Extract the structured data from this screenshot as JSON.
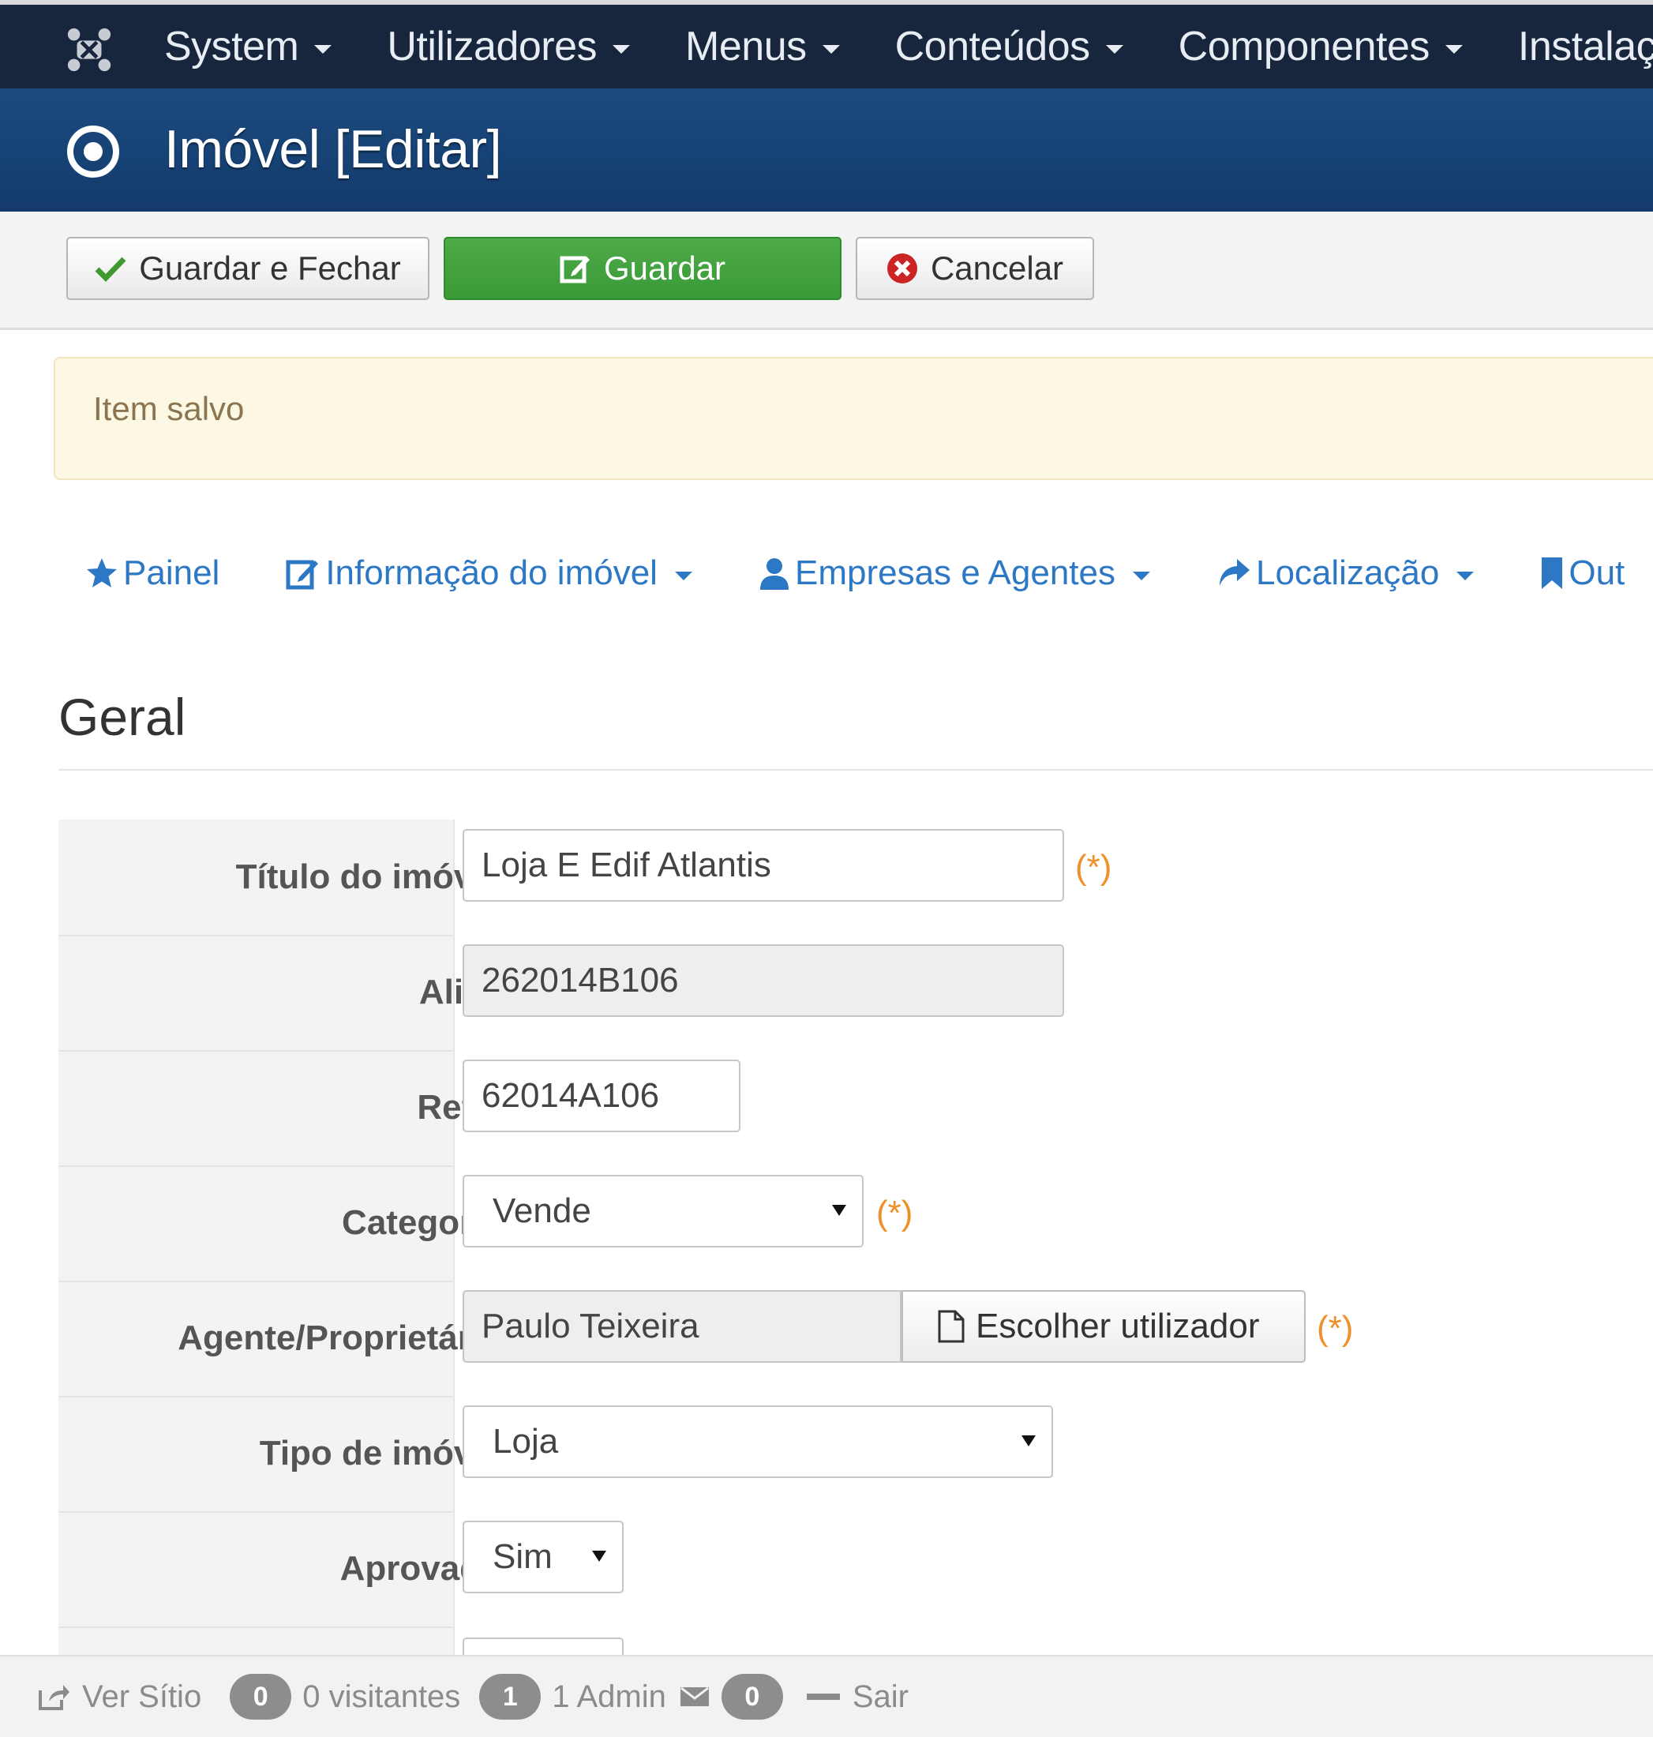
{
  "topnav": {
    "items": [
      {
        "label": "System"
      },
      {
        "label": "Utilizadores"
      },
      {
        "label": "Menus"
      },
      {
        "label": "Conteúdos"
      },
      {
        "label": "Componentes"
      },
      {
        "label": "Instalaç"
      }
    ]
  },
  "header": {
    "title": "Imóvel [Editar]"
  },
  "toolbar": {
    "save_close_label": "Guardar e Fechar",
    "save_label": "Guardar",
    "cancel_label": "Cancelar"
  },
  "alert": {
    "message": "Item salvo"
  },
  "tabs": [
    {
      "label": "Painel",
      "icon": "star-icon"
    },
    {
      "label": "Informação do imóvel",
      "icon": "edit-icon"
    },
    {
      "label": "Empresas e Agentes",
      "icon": "user-icon"
    },
    {
      "label": "Localização",
      "icon": "share-icon"
    },
    {
      "label": "Out",
      "icon": "bookmark-icon"
    }
  ],
  "section": {
    "title": "Geral"
  },
  "form": {
    "required_marker": "(*)",
    "title_label": "Título do imóvel",
    "title_value": "Loja E Edif Atlantis",
    "alias_label": "Alias",
    "alias_value": "262014B106",
    "ref_label": "Ref #",
    "ref_value": "62014A106",
    "category_label": "Categoria",
    "category_value": "Vende",
    "agent_label": "Agente/Proprietário",
    "agent_value": "Paulo Teixeira",
    "choose_user_label": "Escolher utilizador",
    "type_label": "Tipo de imóvel",
    "type_value": "Loja",
    "approved_label": "Aprovado",
    "approved_value": "Sim"
  },
  "statusbar": {
    "view_site_label": "Ver Sítio",
    "visitors_count": "0",
    "visitors_label": "0 visitantes",
    "admin_count": "1",
    "admin_label": "1 Admin",
    "messages_count": "0",
    "logout_label": "Sair"
  },
  "colors": {
    "navbar": "#17253d",
    "header": "#174275",
    "save_button": "#3f9f3c",
    "link": "#2d78c5",
    "required": "#f0902a",
    "alert_bg": "#fcf8e4"
  }
}
